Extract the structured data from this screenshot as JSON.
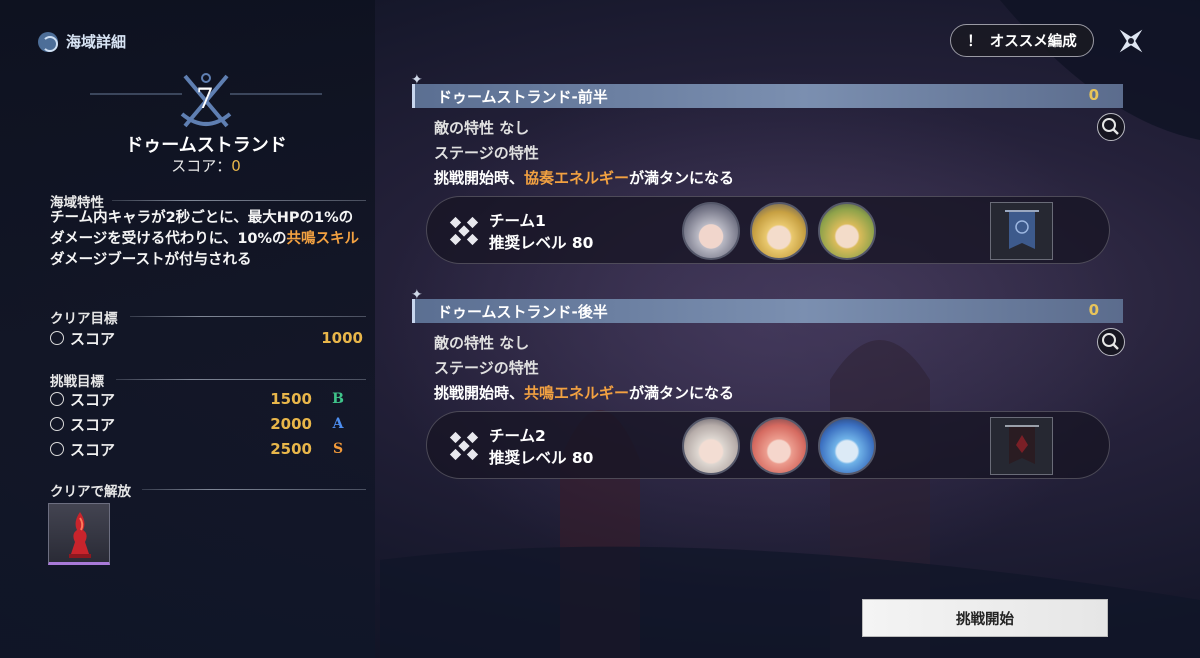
{
  "panel": {
    "title": "海域詳細",
    "zone_number": "7",
    "zone_name": "ドゥームストランド",
    "score_label": "スコア：",
    "score_value": "0"
  },
  "traits": {
    "label": "海域特性",
    "line1": "チーム内キャラが2秒ごとに、最大HPの1%の",
    "line2a": "ダメージを受ける代わりに、10%の",
    "line2b": "共鳴スキル",
    "line3": "ダメージブーストが付与される"
  },
  "clear_goal": {
    "label": "クリア目標",
    "item_label": "スコア",
    "item_value": "1000"
  },
  "challenge_goal": {
    "label": "挑戦目標",
    "items": [
      {
        "label": "スコア",
        "value": "1500",
        "rank": "B",
        "rank_color": "#3fc48a"
      },
      {
        "label": "スコア",
        "value": "2000",
        "rank": "A",
        "rank_color": "#4d8ef0"
      },
      {
        "label": "スコア",
        "value": "2500",
        "rank": "S",
        "rank_color": "#f29a3a"
      }
    ]
  },
  "unlock": {
    "label": "クリアで解放",
    "reward_icon": "crimson-trophy-icon"
  },
  "header": {
    "recommend_mark": "！",
    "recommend_label": "オススメ編成",
    "close_icon": "close-star-icon"
  },
  "stages": [
    {
      "title": "ドゥームストランド-前半",
      "value": "0",
      "enemy_trait": "敵の特性  なし",
      "stage_trait_label": "ステージの特性",
      "desc_a": "挑戦開始時、",
      "desc_b": "協奏エネルギー",
      "desc_c": "が満タンになる",
      "team_name": "チーム1",
      "team_level": "推奨レベル 80",
      "banner_color": "#3d5a8c"
    },
    {
      "title": "ドゥームストランド-後半",
      "value": "0",
      "enemy_trait": "敵の特性  なし",
      "stage_trait_label": "ステージの特性",
      "desc_a": "挑戦開始時、",
      "desc_b": "共鳴エネルギー",
      "desc_c": "が満タンになる",
      "team_name": "チーム2",
      "team_level": "推奨レベル 80",
      "banner_color": "#7a1f26"
    }
  ],
  "footer": {
    "start_label": "挑戦開始"
  },
  "colors": {
    "accent_gold": "#e8b64a",
    "accent_orange": "#f2a141"
  }
}
